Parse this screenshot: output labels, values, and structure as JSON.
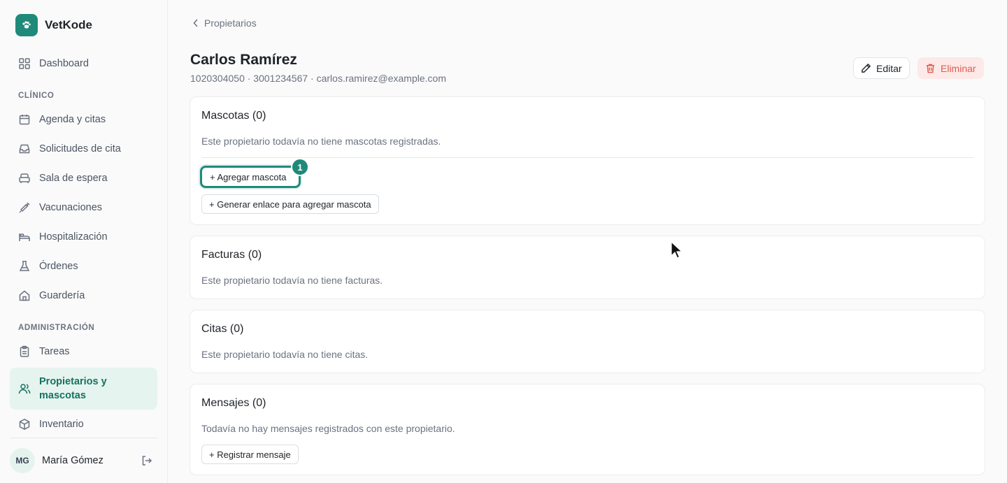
{
  "app": {
    "name": "VetKode"
  },
  "sidebar": {
    "dashboard": "Dashboard",
    "section_clinic": "CLÍNICO",
    "clinic_items": [
      "Agenda y citas",
      "Solicitudes de cita",
      "Sala de espera",
      "Vacunaciones",
      "Hospitalización",
      "Órdenes",
      "Guardería"
    ],
    "section_admin": "ADMINISTRACIÓN",
    "tasks": "Tareas",
    "owners_line1": "Propietarios y",
    "owners_line2": "mascotas",
    "inventory": "Inventario",
    "icons": [
      "grid-icon",
      "calendar-icon",
      "inbox-icon",
      "sofa-icon",
      "syringe-icon",
      "bed-icon",
      "flask-icon",
      "house-icon",
      "clipboard-icon",
      "users-icon",
      "box-icon"
    ]
  },
  "user": {
    "initials": "MG",
    "name": "María Gómez"
  },
  "breadcrumb": {
    "label": "Propietarios"
  },
  "owner": {
    "name": "Carlos Ramírez",
    "details": "1020304050 · 3001234567 · carlos.ramirez@example.com"
  },
  "actions": {
    "edit": "Editar",
    "delete": "Eliminar"
  },
  "pets": {
    "title": "Mascotas (0)",
    "empty": "Este propietario todavía no tiene mascotas registradas.",
    "add_button": "+ Agregar mascota",
    "link_button": "+ Generar enlace para agregar mascota",
    "step_badge": "1"
  },
  "invoices": {
    "title": "Facturas (0)",
    "empty": "Este propietario todavía no tiene facturas."
  },
  "appointments": {
    "title": "Citas (0)",
    "empty": "Este propietario todavía no tiene citas."
  },
  "messages": {
    "title": "Mensajes (0)",
    "empty": "Todavía no hay mensajes registrados con este propietario.",
    "register_button": "+ Registrar mensaje"
  },
  "colors": {
    "accent": "#1f8a7a",
    "danger": "#e05a4e",
    "active_bg": "#e6f4f0"
  }
}
